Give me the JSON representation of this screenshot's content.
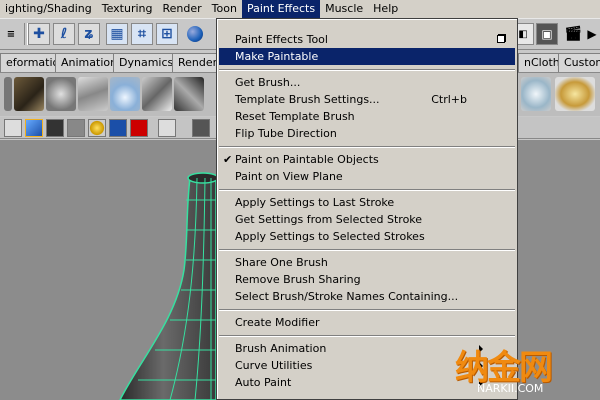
{
  "menubar": {
    "items": [
      "ighting/Shading",
      "Texturing",
      "Render",
      "Toon",
      "Paint Effects",
      "Muscle",
      "Help"
    ],
    "active_index": 4
  },
  "shelf_tabs": [
    "eformation",
    "Animation",
    "Dynamics",
    "Renderi",
    "nCloth",
    "Custom"
  ],
  "menu": {
    "items": [
      {
        "label": "Paint Effects Tool",
        "option_box": true
      },
      {
        "label": "Make Paintable",
        "highlighted": true
      },
      {
        "label": "Get Brush..."
      },
      {
        "label": "Template Brush Settings...",
        "shortcut": "Ctrl+b"
      },
      {
        "label": "Reset Template Brush"
      },
      {
        "label": "Flip Tube Direction"
      },
      {
        "label": "Paint on Paintable Objects",
        "checked": true
      },
      {
        "label": "Paint on View Plane"
      },
      {
        "label": "Apply Settings to Last Stroke"
      },
      {
        "label": "Get Settings from Selected Stroke"
      },
      {
        "label": "Apply Settings to Selected Strokes"
      },
      {
        "label": "Share One Brush"
      },
      {
        "label": "Remove Brush Sharing"
      },
      {
        "label": "Select Brush/Stroke Names Containing..."
      },
      {
        "label": "Create Modifier"
      },
      {
        "label": "Brush Animation",
        "submenu": true
      },
      {
        "label": "Curve Utilities",
        "submenu": true
      },
      {
        "label": "Auto Paint",
        "submenu": true
      }
    ],
    "check_glyph": "✔"
  },
  "watermark": {
    "chinese": "纳金网",
    "latin": "NARKII.COM"
  },
  "colors": {
    "menu_highlight": "#0a246a",
    "menu_bg": "#d4d0c8",
    "viewport_bg": "#8c8c8c",
    "wireframe": "#37e0a0",
    "watermark": "#f08a10"
  },
  "icons": {
    "toolbar": [
      "dropdown-icon",
      "move-icon",
      "lasso-icon",
      "paint-select-icon",
      "snap-grid-icon",
      "snap-curve-icon",
      "snap-point-icon",
      "sphere-icon",
      "history-icon",
      "render-icon",
      "clapper-icon",
      "ipr-icon"
    ],
    "panel": [
      "wireframe-cube-icon",
      "shaded-cube-icon",
      "textured-cube-icon",
      "smooth-cube-icon",
      "light-icon",
      "shadow-icon",
      "xray-icon",
      "isolate-icon",
      "frame-icon"
    ]
  }
}
